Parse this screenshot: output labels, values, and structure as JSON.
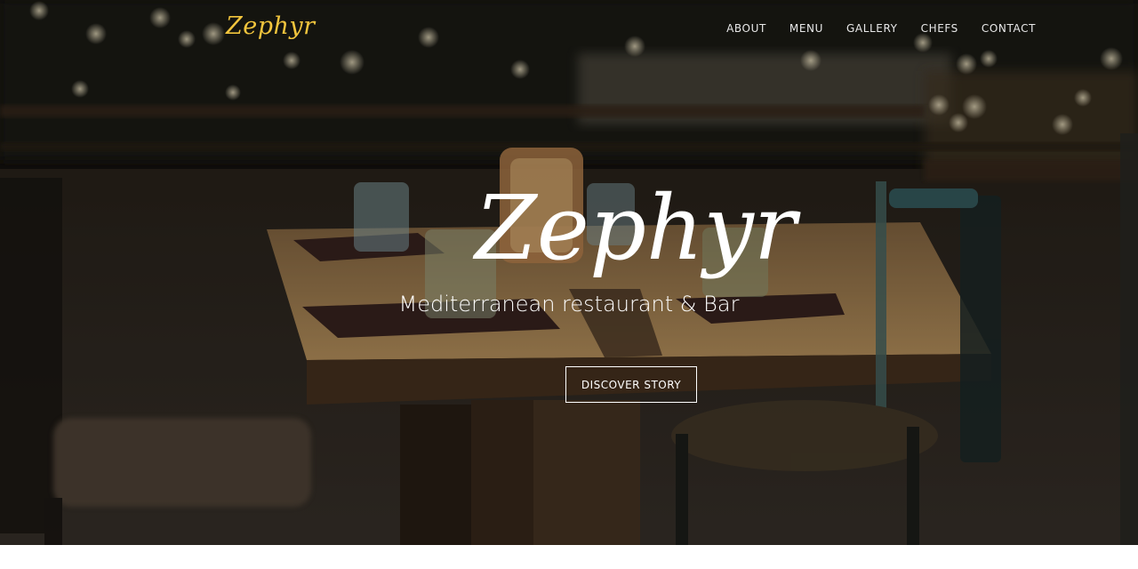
{
  "navbar": {
    "brand": "Zephyr",
    "links": [
      "ABOUT",
      "MENU",
      "GALLERY",
      "CHEFS",
      "CONTACT"
    ]
  },
  "hero": {
    "title": "Zephyr",
    "subtitle": "Mediterranean restaurant & Bar",
    "cta_label": "DISCOVER STORY",
    "background_image": "night-restaurant-terrace-table-photo"
  },
  "colors": {
    "brand": "#f2c53d",
    "text": "#ffffff",
    "nav_text": "#e8e8e8"
  }
}
